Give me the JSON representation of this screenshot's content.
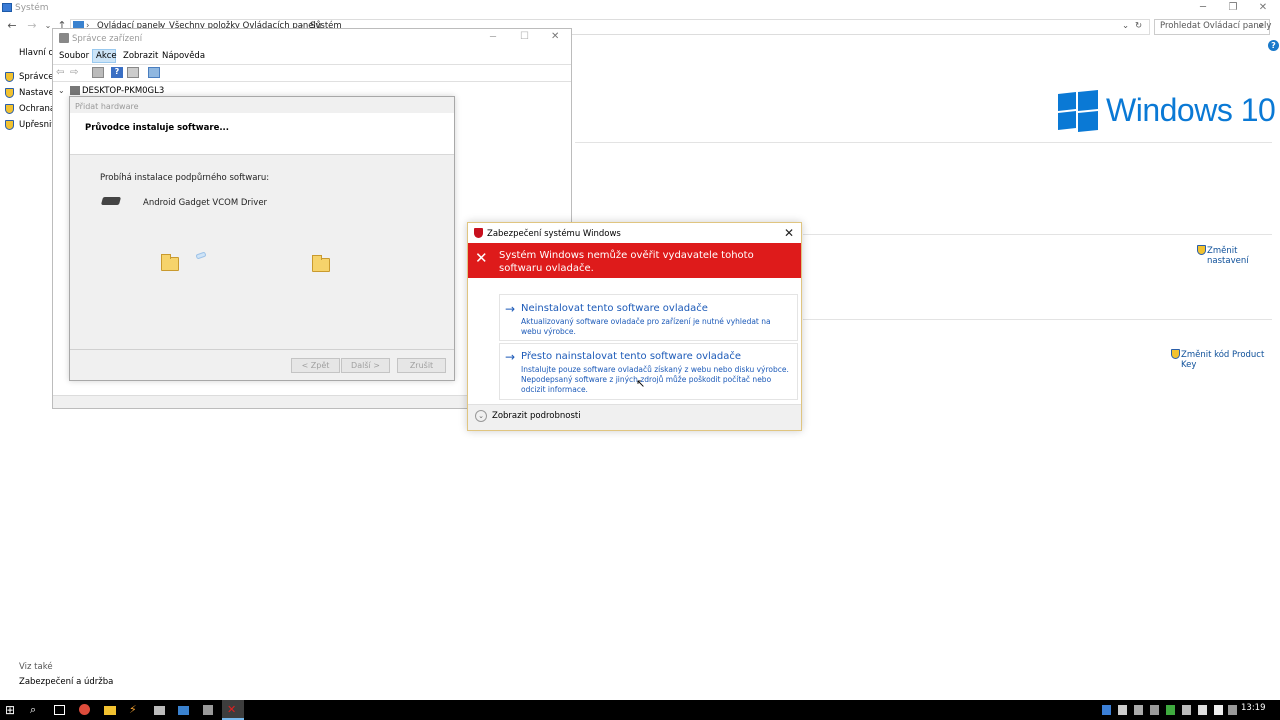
{
  "system_window": {
    "title": "Systém",
    "breadcrumb": [
      "Ovládací panely",
      "Všechny položky Ovládacích panelů",
      "Systém"
    ],
    "search_placeholder": "Prohledat Ovládací panely",
    "sidebar": {
      "home": "Hlavní ov",
      "items": [
        "Správce z",
        "Nastaven",
        "Ochrana",
        "Upřesnit"
      ]
    },
    "see_also": {
      "heading": "Viz také",
      "link": "Zabezpečení a údržba"
    },
    "brand": "Windows 10",
    "links": {
      "change_settings": "Změnit nastavení",
      "change_key": "Změnit kód Product Key"
    }
  },
  "device_manager": {
    "title": "Správce zařízení",
    "menu": [
      "Soubor",
      "Akce",
      "Zobrazit",
      "Nápověda"
    ],
    "active_menu": "Akce",
    "tree_root": "DESKTOP-PKM0GL3"
  },
  "wizard": {
    "title": "Přidat hardware",
    "heading": "Průvodce instaluje software...",
    "status": "Probíhá instalace podpůrného softwaru:",
    "device": "Android Gadget VCOM Driver",
    "buttons": {
      "back": "< Zpět",
      "next": "Další >",
      "cancel": "Zrušit"
    }
  },
  "security_dialog": {
    "title": "Zabezpečení systému Windows",
    "banner": "Systém Windows nemůže ověřit vydavatele tohoto softwaru ovladače.",
    "options": [
      {
        "title": "Neinstalovat tento software ovladače",
        "description": "Aktualizovaný software ovladače pro zařízení je nutné vyhledat na webu výrobce."
      },
      {
        "title": "Přesto nainstalovat tento software ovladače",
        "description": "Instalujte pouze software ovladačů získaný z webu nebo disku výrobce. Nepodepsaný software z jiných zdrojů může poškodit počítač nebo odcizit informace."
      }
    ],
    "details": "Zobrazit podrobnosti"
  },
  "taskbar": {
    "clock": "13:19",
    "icons": [
      "windows-start",
      "search",
      "task-view",
      "chrome",
      "file-explorer",
      "app",
      "app",
      "app",
      "device-manager",
      "security-app"
    ]
  }
}
